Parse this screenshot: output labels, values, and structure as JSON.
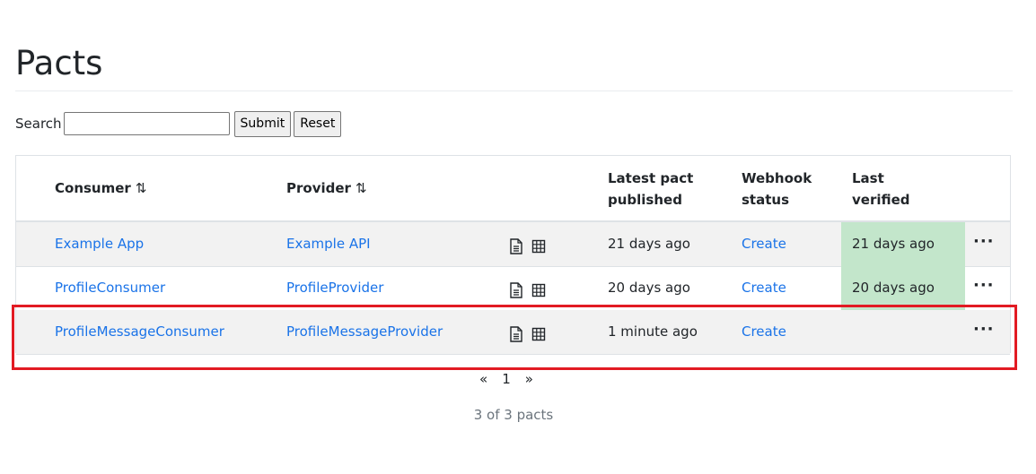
{
  "page": {
    "title": "Pacts"
  },
  "search": {
    "label": "Search",
    "value": "",
    "submit_label": "Submit",
    "reset_label": "Reset"
  },
  "table": {
    "headers": {
      "consumer": "Consumer",
      "provider": "Provider",
      "latest_line1": "Latest pact",
      "latest_line2": "published",
      "webhook_line1": "Webhook",
      "webhook_line2": "status",
      "verified_line1": "Last",
      "verified_line2": "verified",
      "sort_glyph": "⇅"
    },
    "rows": [
      {
        "consumer": "Example App",
        "provider": "Example API",
        "published": "21 days ago",
        "webhook": "Create",
        "last_verified": "21 days ago",
        "verified_status": "success",
        "more": "···"
      },
      {
        "consumer": "ProfileConsumer",
        "provider": "ProfileProvider",
        "published": "20 days ago",
        "webhook": "Create",
        "last_verified": "20 days ago",
        "verified_status": "success",
        "more": "···"
      },
      {
        "consumer": "ProfileMessageConsumer",
        "provider": "ProfileMessageProvider",
        "published": "1 minute ago",
        "webhook": "Create",
        "last_verified": "",
        "verified_status": "none",
        "more": "···"
      }
    ],
    "row_icons": [
      "document-icon",
      "matrix-icon"
    ]
  },
  "pagination": {
    "prev": "«",
    "page": "1",
    "next": "»",
    "status": "3 of 3 pacts"
  },
  "colors": {
    "link": "#1a73e8",
    "verified_success": "#c3e6cb",
    "highlight_border": "#e21b23",
    "stripe": "#f2f2f2"
  }
}
